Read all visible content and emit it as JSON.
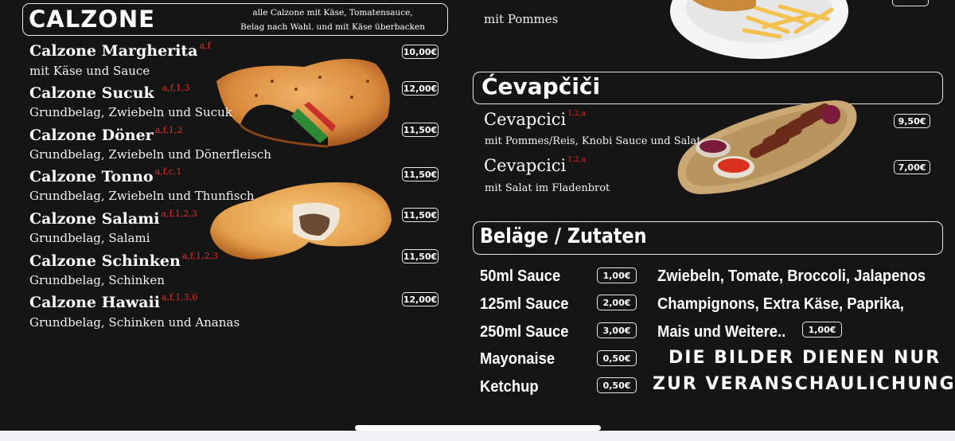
{
  "calzone": {
    "title": "CALZONE",
    "note_line1": "alle Calzone mit Käse, Tomatensauce,",
    "note_line2": "Belag nach Wahl. und mit Käse überbacken",
    "items": [
      {
        "name": "Calzone Margherita",
        "codes": "a,f",
        "desc": "mit Käse und Sauce",
        "price": "10,00€"
      },
      {
        "name": "Calzone Sucuk",
        "codes": "a,f,1,3",
        "desc": "Grundbelag, Zwiebeln und Sucuk",
        "price": "12,00€"
      },
      {
        "name": "Calzone Döner",
        "codes": "a,f,1,2",
        "desc": "Grundbelag, Zwiebeln und Dönerfleisch",
        "price": "11,50€"
      },
      {
        "name": "Calzone Tonno",
        "codes": "a,f,c,1",
        "desc": "Grundbelag, Zwiebeln und Thunfisch",
        "price": "11,50€"
      },
      {
        "name": "Calzone Salami",
        "codes": "a,f,1,2,3",
        "desc": "Grundbelag, Salami",
        "price": "11,50€"
      },
      {
        "name": "Calzone Schinken",
        "codes": "a,f,1,2,3",
        "desc": "Grundbelag, Schinken",
        "price": "11,50€"
      },
      {
        "name": "Calzone Hawaii",
        "codes": "a,f,1,3,6",
        "desc": "Grundbelag, Schinken und Ananas",
        "price": "12,00€"
      }
    ]
  },
  "schnitzel": {
    "desc": "mit Pommes"
  },
  "cevapcici": {
    "title": "Ćevapčiči",
    "items": [
      {
        "name": "Cevapcici",
        "codes": "1,2,a",
        "desc": "mit Pommes/Reis, Knobi Sauce und Salat",
        "price": "9,50€"
      },
      {
        "name": "Cevapcici",
        "codes": "1,2,a",
        "desc": "mit Salat im Fladenbrot",
        "price": "7,00€"
      }
    ]
  },
  "belaege": {
    "title": "Beläge / Zutaten",
    "toppings": [
      {
        "name": "50ml Sauce",
        "price": "1,00€"
      },
      {
        "name": "125ml Sauce",
        "price": "2,00€"
      },
      {
        "name": "250ml Sauce",
        "price": "3,00€"
      },
      {
        "name": "Mayonaise",
        "price": "0,50€"
      },
      {
        "name": "Ketchup",
        "price": "0,50€"
      }
    ],
    "ingredients_line1": "Zwiebeln, Tomate, Broccoli, Jalapenos",
    "ingredients_line2": "Champignons, Extra Käse, Paprika,",
    "ingredients_line3": "Mais und Weitere..",
    "ingredients_price": "1,00€",
    "disclaimer_line1": "DIE BILDER DIENEN NUR",
    "disclaimer_line2": "ZUR VERANSCHAULICHUNG"
  }
}
